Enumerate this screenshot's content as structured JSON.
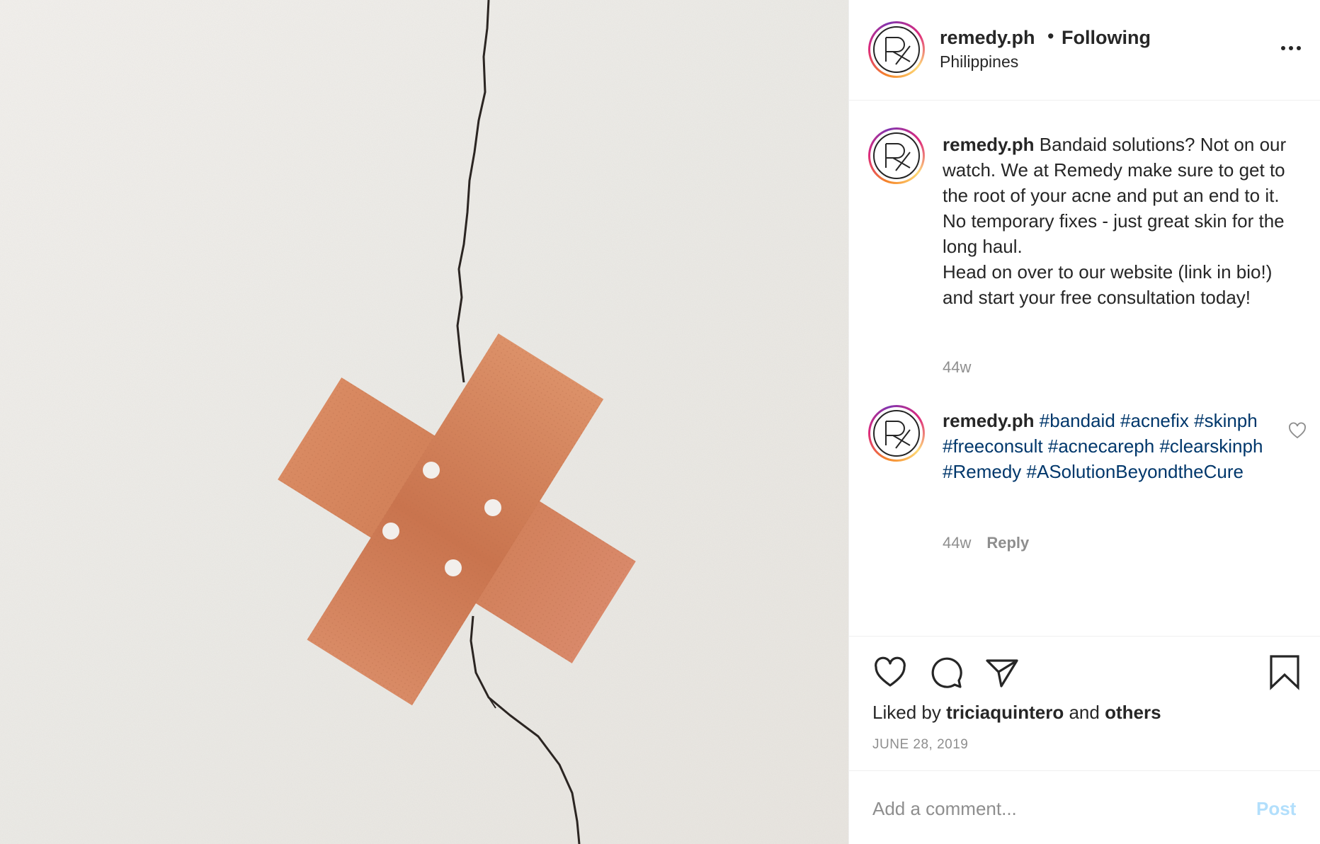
{
  "post": {
    "username": "remedy.ph",
    "separator": "•",
    "follow_status": "Following",
    "location": "Philippines",
    "avatar_text": "Rx"
  },
  "caption": {
    "username": "remedy.ph",
    "text": "Bandaid solutions? Not on our watch. We at Remedy make sure to get to the root of your acne and put an end to it. No temporary fixes - just great skin for the long haul.",
    "text2": "Head on over to our website (link in bio!) and start your free consultation today!",
    "time": "44w"
  },
  "comment": {
    "username": "remedy.ph",
    "hashtags": [
      "#bandaid",
      "#acnefix",
      "#skinph",
      "#freeconsult",
      "#acnecareph",
      "#clearskinph",
      "#Remedy",
      "#ASolutionBeyondtheCure"
    ],
    "time": "44w",
    "reply_label": "Reply"
  },
  "actions": {
    "liked_by_prefix": "Liked by",
    "liked_by_user": "triciaquintero",
    "liked_by_and": "and",
    "liked_by_others": "others",
    "date": "JUNE 28, 2019"
  },
  "add_comment": {
    "placeholder": "Add a comment...",
    "post_label": "Post"
  },
  "icons": [
    "more-icon",
    "heart-icon",
    "comment-icon",
    "share-icon",
    "bookmark-icon",
    "small-heart-icon"
  ],
  "colors": {
    "hashtag": "#00376b",
    "meta_gray": "#8e8e8e",
    "post_button_disabled": "#b2dffc",
    "bandage": "#d9875f"
  }
}
